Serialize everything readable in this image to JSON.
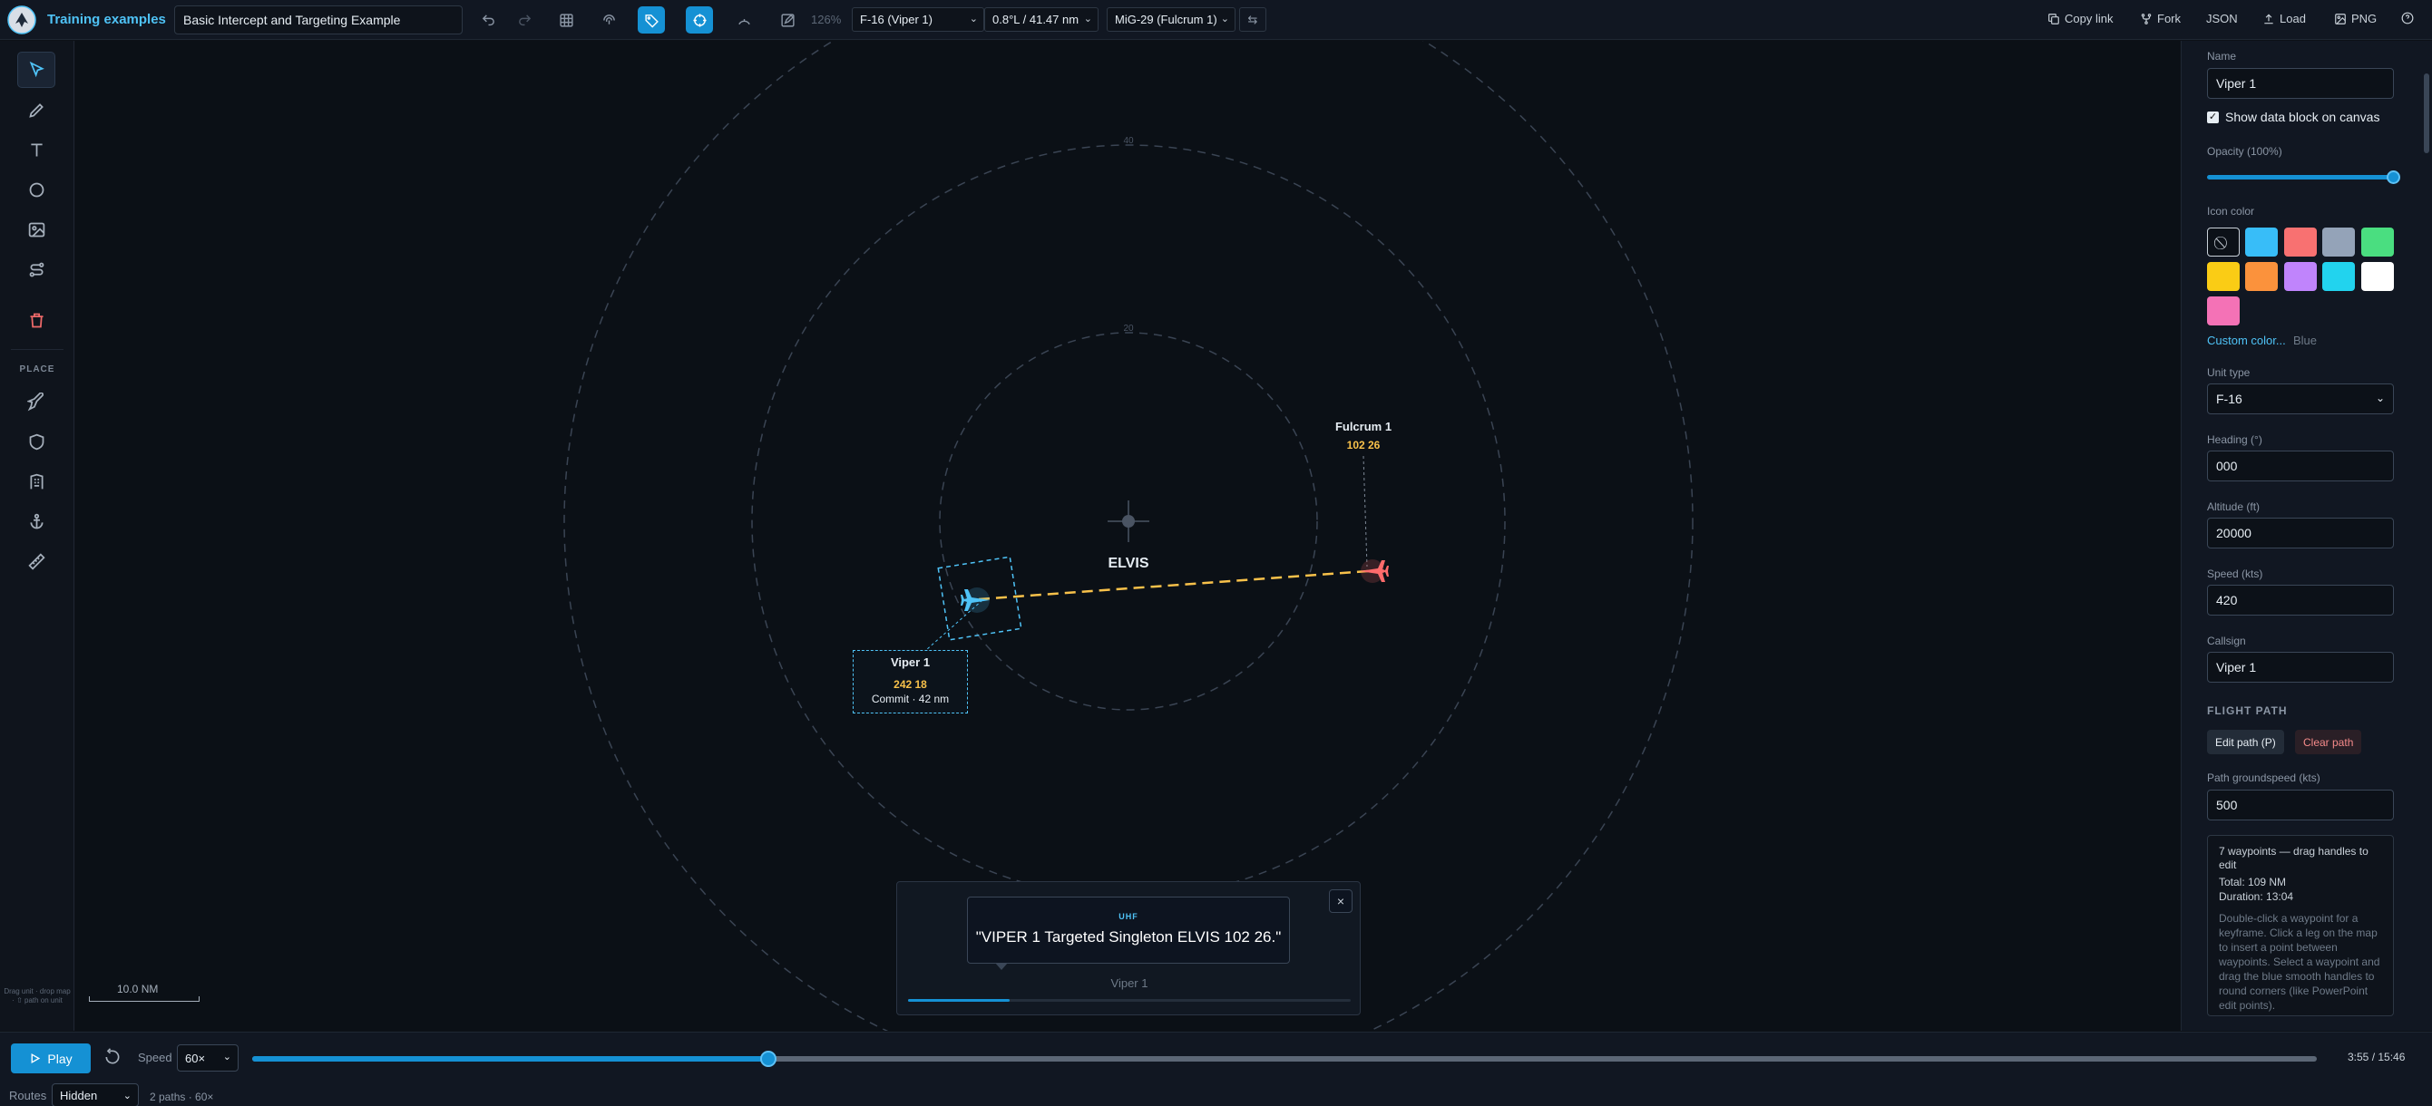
{
  "app": {
    "title": "Training examples"
  },
  "toolbar": {
    "doc_title": "Basic Intercept and Targeting Example",
    "zoom": "126%",
    "from_unit": "F-16 (Viper 1)",
    "range_readout": "0.8°L / 41.47 nm",
    "to_unit": "MiG-29 (Fulcrum 1)",
    "copy_link": "Copy link",
    "fork": "Fork",
    "json": "JSON",
    "load": "Load",
    "png": "PNG",
    "icons": [
      "undo-icon",
      "redo-icon",
      "grid-icon",
      "fingerprint-icon",
      "tag-icon",
      "crosshair-icon",
      "arc-icon",
      "edit-icon",
      "swap-icon",
      "link-icon",
      "fork-icon",
      "upload-icon",
      "image-icon",
      "help-icon"
    ]
  },
  "left_tools": {
    "place_label": "PLACE",
    "hint": "Drag unit · drop map · ⇧ path on unit",
    "icons": [
      "pointer-icon",
      "pencil-icon",
      "text-icon",
      "circle-icon",
      "image-icon",
      "route-icon",
      "trash-icon",
      "plane-icon",
      "shield-icon",
      "building-icon",
      "anchor-icon",
      "ruler-icon"
    ]
  },
  "map": {
    "bullseye_name": "ELVIS",
    "ring_labels": [
      "40",
      "20"
    ],
    "scale": "10.0 NM",
    "friendly": {
      "callsign": "Viper 1",
      "values": "242 18",
      "status": "Commit · 42 nm",
      "color": "#4fc3f7"
    },
    "hostile": {
      "callsign": "Fulcrum 1",
      "values": "102 26",
      "color": "#ff6b6b"
    },
    "intercept_line_color": "#f8c14a"
  },
  "radio": {
    "channel": "UHF",
    "message": "\"VIPER 1 Targeted Singleton ELVIS 102 26.\"",
    "speaker": "Viper 1",
    "close": "×",
    "progress": 0.23
  },
  "panel": {
    "name_label": "Name",
    "name_value": "Viper 1",
    "show_datablock": "Show data block on canvas",
    "opacity_label": "Opacity (100%)",
    "opacity": 1.0,
    "icon_color_label": "Icon color",
    "colors": [
      "#38bdf8",
      "#f87171",
      "#94a3b8",
      "#4ade80",
      "#facc15",
      "#fb923c",
      "#c084fc",
      "#22d3ee",
      "#ffffff",
      "#f472b6"
    ],
    "custom_color": "Custom color...",
    "current_color": "Blue",
    "unit_type_label": "Unit type",
    "unit_type": "F-16",
    "heading_label": "Heading (°)",
    "heading": "000",
    "altitude_label": "Altitude (ft)",
    "altitude": "20000",
    "speed_label": "Speed (kts)",
    "speed": "420",
    "callsign_label": "Callsign",
    "callsign": "Viper 1",
    "flight_path_title": "FLIGHT PATH",
    "edit_path": "Edit path (P)",
    "clear_path": "Clear path",
    "groundspeed_label": "Path groundspeed (kts)",
    "groundspeed": "500",
    "waypoints": "7 waypoints — drag handles to edit",
    "total": "Total: 109 NM",
    "duration": "Duration: 13:04",
    "help": "Double-click a waypoint for a keyframe. Click a leg on the map to insert a point between waypoints. Select a waypoint and drag the blue smooth handles to round corners (like PowerPoint edit points)."
  },
  "bottom": {
    "play": "Play",
    "speed_label": "Speed",
    "speed": "60×",
    "progress": 0.25,
    "time": "3:55 / 15:46",
    "routes_label": "Routes",
    "routes": "Hidden",
    "paths_info": "2 paths · 60×"
  }
}
